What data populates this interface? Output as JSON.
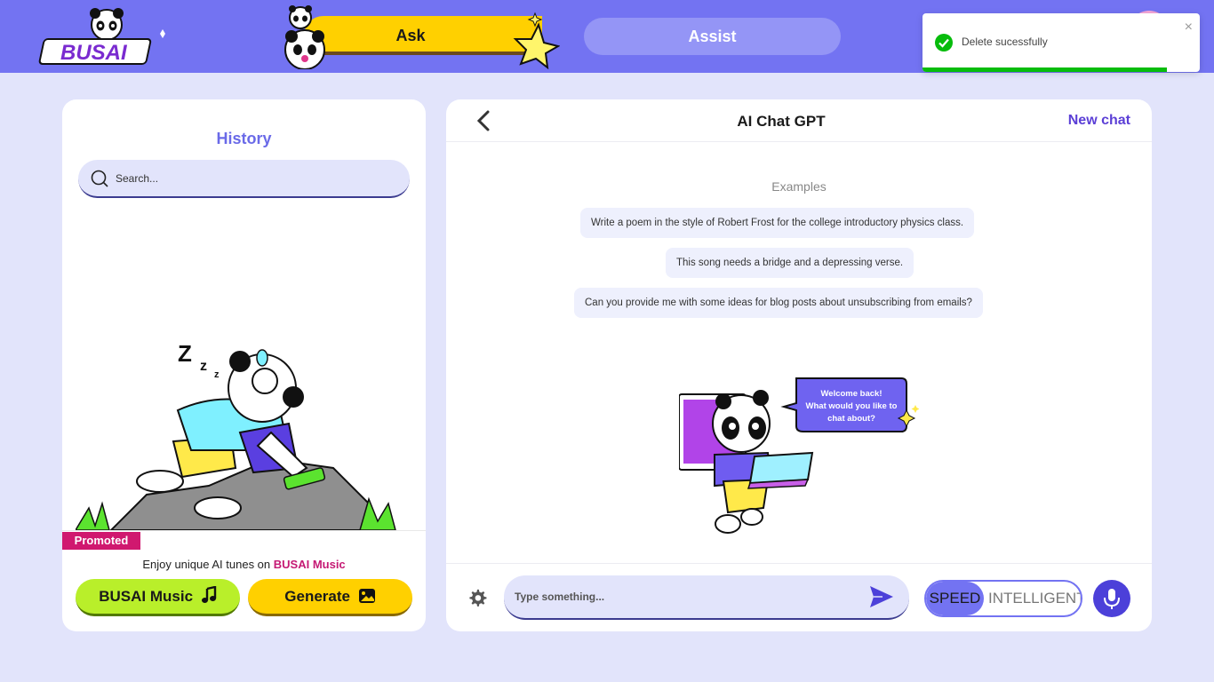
{
  "brand": {
    "logo_text": "BUSAI"
  },
  "header": {
    "ask_label": "Ask",
    "assist_label": "Assist"
  },
  "toast": {
    "message": "Delete sucessfully",
    "close_glyph": "×",
    "progress": 0.88,
    "color": "#07bc0c"
  },
  "history": {
    "title": "History",
    "search_placeholder": "Search..."
  },
  "promo": {
    "badge": "Promoted",
    "text_prefix": "Enjoy unique AI tunes on ",
    "brand_link": "BUSAI Music",
    "music_button": "BUSAI Music",
    "generate_button": "Generate"
  },
  "chat": {
    "title": "AI Chat GPT",
    "new_chat": "New chat",
    "examples_title": "Examples",
    "examples": [
      "Write a poem in the style of Robert Frost for the college introductory physics class.",
      "This song needs a bridge and a depressing verse.",
      "Can you provide me with some ideas for blog posts about unsubscribing from emails?"
    ],
    "bubble_text": [
      "Welcome back!",
      "What would you like to",
      "chat about?"
    ],
    "input_placeholder": "Type something...",
    "mode_speed": "SPEED",
    "mode_intelligent": "INTELLIGENT",
    "mode_selected": "SPEED"
  },
  "colors": {
    "header_bg": "#7373f2",
    "page_bg": "#e2e4fb",
    "accent": "#6a6ae8",
    "yellow": "#ffd000",
    "lime": "#b9ef2a",
    "promo_pink": "#d0186f"
  },
  "icons": [
    "search-icon",
    "back-arrow-icon",
    "gear-icon",
    "send-icon",
    "mic-icon",
    "music-note-icon",
    "image-icon",
    "check-icon",
    "close-icon"
  ]
}
